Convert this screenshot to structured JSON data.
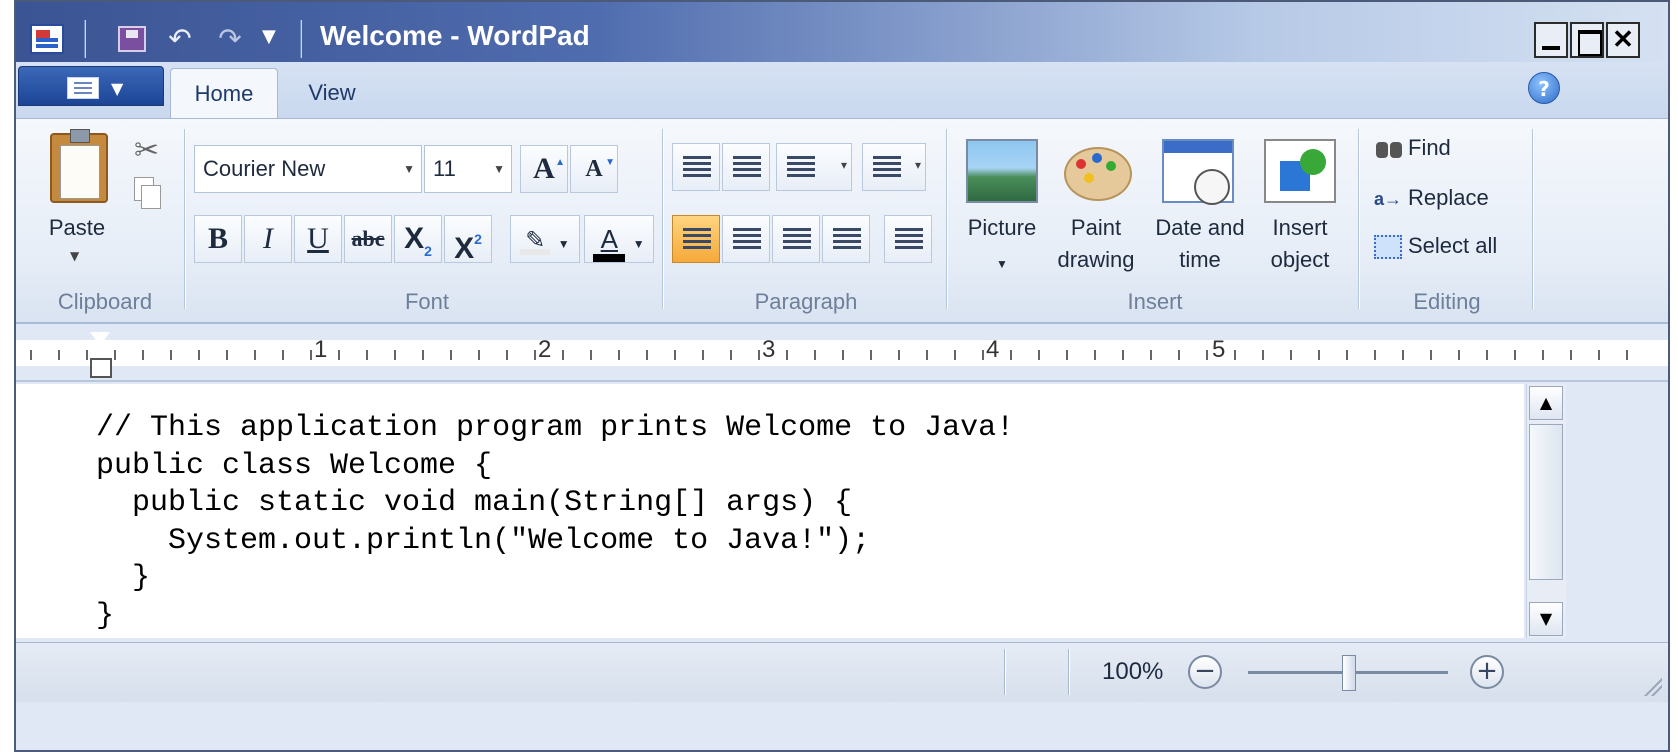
{
  "window": {
    "title": "Welcome - WordPad",
    "controls": {
      "minimize": "_",
      "maximize": "□",
      "close": "✕"
    }
  },
  "quick_access": {
    "customize_arrow": "▼"
  },
  "tabs": [
    {
      "label": "Home",
      "active": true
    },
    {
      "label": "View",
      "active": false
    }
  ],
  "help": {
    "glyph": "?"
  },
  "ribbon": {
    "clipboard": {
      "group_label": "Clipboard",
      "paste_label": "Paste"
    },
    "font": {
      "group_label": "Font",
      "font_name": "Courier New",
      "font_size": "11",
      "bold": "B",
      "italic": "I",
      "underline": "U",
      "strike": "abc",
      "subscript": "X",
      "superscript": "X",
      "font_color_glyph": "A"
    },
    "paragraph": {
      "group_label": "Paragraph"
    },
    "insert": {
      "group_label": "Insert",
      "picture": "Picture",
      "paint_line1": "Paint",
      "paint_line2": "drawing",
      "date_line1": "Date and",
      "date_line2": "time",
      "object_line1": "Insert",
      "object_line2": "object"
    },
    "editing": {
      "group_label": "Editing",
      "find": "Find",
      "replace": "Replace",
      "select_all": "Select all"
    }
  },
  "ruler": {
    "numbers": [
      "1",
      "2",
      "3",
      "4",
      "5"
    ]
  },
  "document": {
    "lines": [
      "// This application program prints Welcome to Java!",
      "public class Welcome {",
      "  public static void main(String[] args) {",
      "    System.out.println(\"Welcome to Java!\");",
      "  }",
      "}"
    ]
  },
  "statusbar": {
    "zoom": "100%",
    "zoom_out": "−",
    "zoom_in": "+",
    "zoom_fraction": 0.5
  },
  "colors": {
    "titlebar": "#3b5493",
    "ribbon": "#e6edf7",
    "active_align": "#f5a93a"
  }
}
